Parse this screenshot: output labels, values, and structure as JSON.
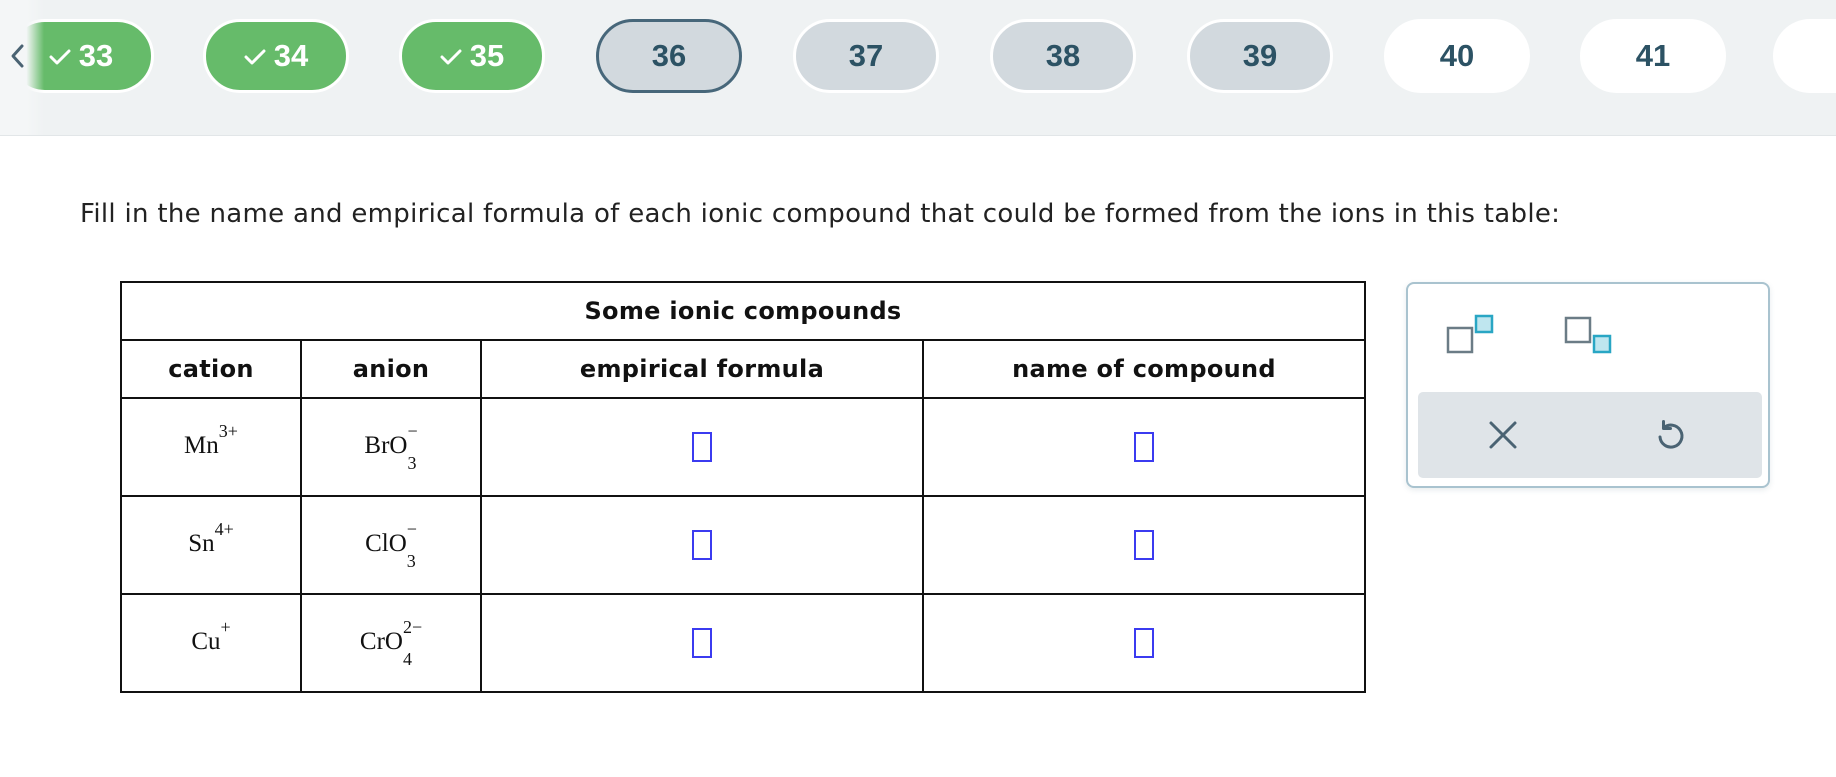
{
  "nav": {
    "back_icon": "chevron-left-icon",
    "items": [
      {
        "label": "33",
        "state": "done"
      },
      {
        "label": "34",
        "state": "done"
      },
      {
        "label": "35",
        "state": "done"
      },
      {
        "label": "36",
        "state": "current"
      },
      {
        "label": "37",
        "state": "visited"
      },
      {
        "label": "38",
        "state": "visited"
      },
      {
        "label": "39",
        "state": "visited"
      },
      {
        "label": "40",
        "state": "todo"
      },
      {
        "label": "41",
        "state": "todo"
      },
      {
        "label": "",
        "state": "todo"
      }
    ]
  },
  "question": {
    "prompt": "Fill in the name and empirical formula of each ionic compound that could be formed from the ions in this table:"
  },
  "table": {
    "caption": "Some ionic compounds",
    "headers": [
      "cation",
      "anion",
      "empirical formula",
      "name of compound"
    ],
    "rows": [
      {
        "cation": {
          "symbol": "Mn",
          "charge": "3+"
        },
        "anion": {
          "symbol": "BrO",
          "subscript": "3",
          "charge": "−"
        },
        "empirical_formula": "",
        "name": ""
      },
      {
        "cation": {
          "symbol": "Sn",
          "charge": "4+"
        },
        "anion": {
          "symbol": "ClO",
          "subscript": "3",
          "charge": "−"
        },
        "empirical_formula": "",
        "name": ""
      },
      {
        "cation": {
          "symbol": "Cu",
          "charge": "+"
        },
        "anion": {
          "symbol": "CrO",
          "subscript": "4",
          "charge": "2−"
        },
        "empirical_formula": "",
        "name": ""
      }
    ]
  },
  "tools": {
    "superscript_icon": "superscript-icon",
    "subscript_icon": "subscript-icon",
    "clear_icon": "close-icon",
    "undo_icon": "undo-icon"
  },
  "colors": {
    "done": "#66bb6a",
    "current_border": "#47677a",
    "pill_text": "#2c5264",
    "answer_box": "#3b3bf0",
    "tool_accent": "#29a6c4"
  }
}
